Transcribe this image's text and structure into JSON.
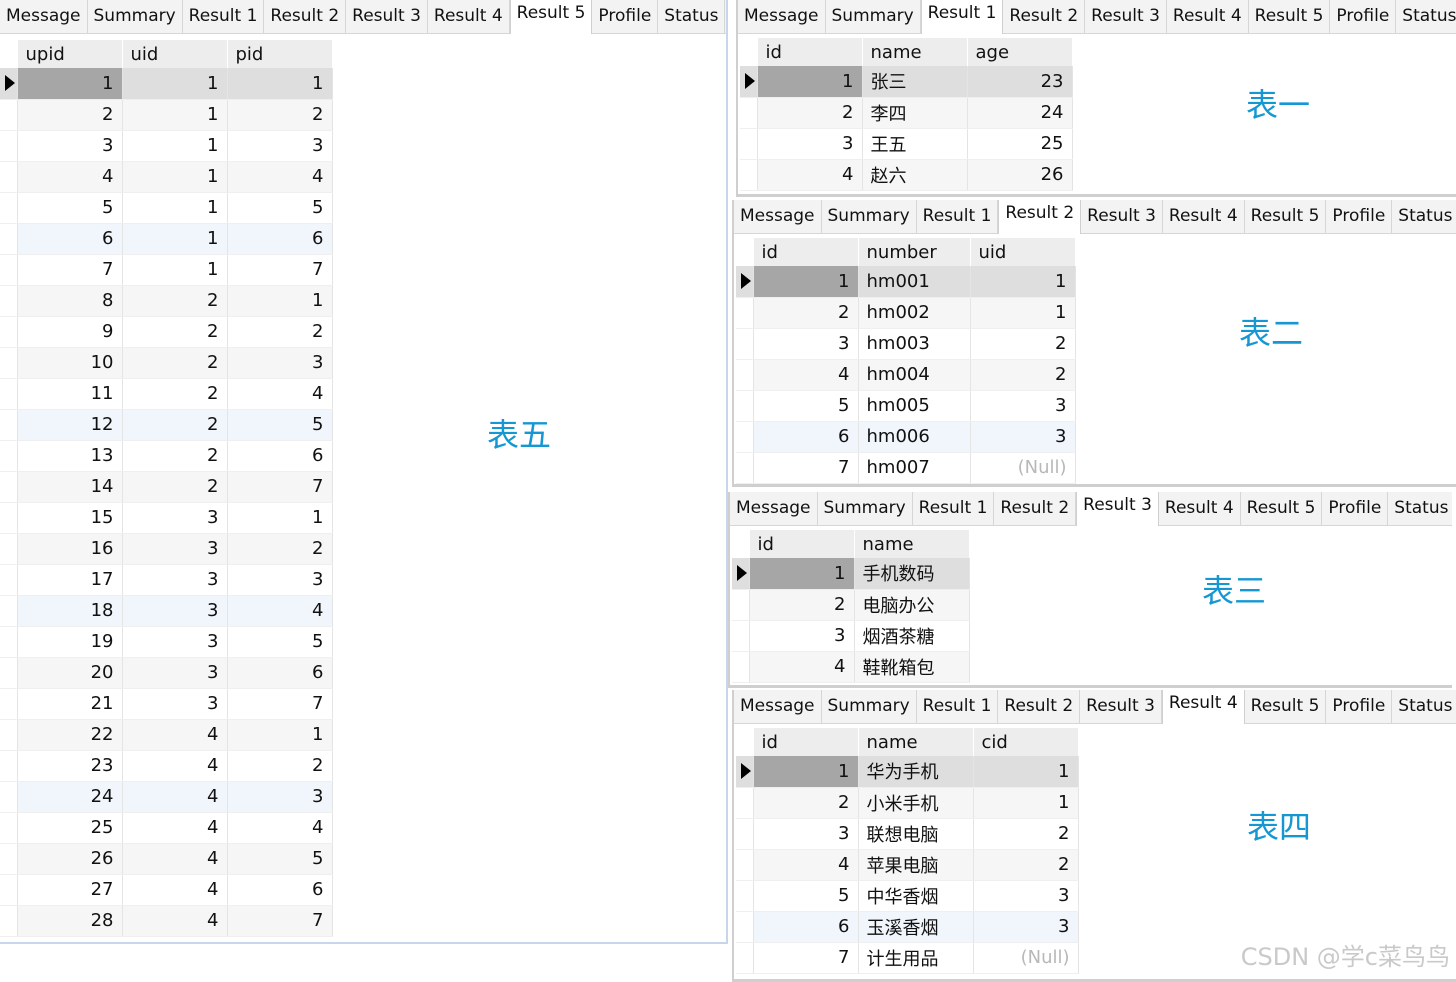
{
  "tabs": [
    "Message",
    "Summary",
    "Result 1",
    "Result 2",
    "Result 3",
    "Result 4",
    "Result 5",
    "Profile",
    "Status"
  ],
  "panel_left": {
    "active_tab": 6,
    "label": "表五",
    "columns": [
      "upid",
      "uid",
      "pid"
    ],
    "rows": [
      [
        "1",
        "1",
        "1"
      ],
      [
        "2",
        "1",
        "2"
      ],
      [
        "3",
        "1",
        "3"
      ],
      [
        "4",
        "1",
        "4"
      ],
      [
        "5",
        "1",
        "5"
      ],
      [
        "6",
        "1",
        "6"
      ],
      [
        "7",
        "1",
        "7"
      ],
      [
        "8",
        "2",
        "1"
      ],
      [
        "9",
        "2",
        "2"
      ],
      [
        "10",
        "2",
        "3"
      ],
      [
        "11",
        "2",
        "4"
      ],
      [
        "12",
        "2",
        "5"
      ],
      [
        "13",
        "2",
        "6"
      ],
      [
        "14",
        "2",
        "7"
      ],
      [
        "15",
        "3",
        "1"
      ],
      [
        "16",
        "3",
        "2"
      ],
      [
        "17",
        "3",
        "3"
      ],
      [
        "18",
        "3",
        "4"
      ],
      [
        "19",
        "3",
        "5"
      ],
      [
        "20",
        "3",
        "6"
      ],
      [
        "21",
        "3",
        "7"
      ],
      [
        "22",
        "4",
        "1"
      ],
      [
        "23",
        "4",
        "2"
      ],
      [
        "24",
        "4",
        "3"
      ],
      [
        "25",
        "4",
        "4"
      ],
      [
        "26",
        "4",
        "5"
      ],
      [
        "27",
        "4",
        "6"
      ],
      [
        "28",
        "4",
        "7"
      ]
    ]
  },
  "panel_1": {
    "active_tab": 2,
    "label": "表一",
    "columns": [
      "id",
      "name",
      "age"
    ],
    "rows": [
      [
        "1",
        "张三",
        "23"
      ],
      [
        "2",
        "李四",
        "24"
      ],
      [
        "3",
        "王五",
        "25"
      ],
      [
        "4",
        "赵六",
        "26"
      ]
    ]
  },
  "panel_2": {
    "active_tab": 3,
    "label": "表二",
    "columns": [
      "id",
      "number",
      "uid"
    ],
    "rows": [
      [
        "1",
        "hm001",
        "1"
      ],
      [
        "2",
        "hm002",
        "1"
      ],
      [
        "3",
        "hm003",
        "2"
      ],
      [
        "4",
        "hm004",
        "2"
      ],
      [
        "5",
        "hm005",
        "3"
      ],
      [
        "6",
        "hm006",
        "3"
      ],
      [
        "7",
        "hm007",
        "(Null)"
      ]
    ]
  },
  "panel_3": {
    "active_tab": 4,
    "label": "表三",
    "columns": [
      "id",
      "name"
    ],
    "rows": [
      [
        "1",
        "手机数码"
      ],
      [
        "2",
        "电脑办公"
      ],
      [
        "3",
        "烟酒茶糖"
      ],
      [
        "4",
        "鞋靴箱包"
      ]
    ]
  },
  "panel_4": {
    "active_tab": 5,
    "label": "表四",
    "columns": [
      "id",
      "name",
      "cid"
    ],
    "rows": [
      [
        "1",
        "华为手机",
        "1"
      ],
      [
        "2",
        "小米手机",
        "1"
      ],
      [
        "3",
        "联想电脑",
        "2"
      ],
      [
        "4",
        "苹果电脑",
        "2"
      ],
      [
        "5",
        "中华香烟",
        "3"
      ],
      [
        "6",
        "玉溪香烟",
        "3"
      ],
      [
        "7",
        "计生用品",
        "(Null)"
      ]
    ]
  },
  "watermark": "CSDN @学c菜鸟鸟",
  "colors": {
    "label": "#1597d3",
    "selected_cell": "#a6a6a6",
    "null_text": "#b8b8b8"
  }
}
